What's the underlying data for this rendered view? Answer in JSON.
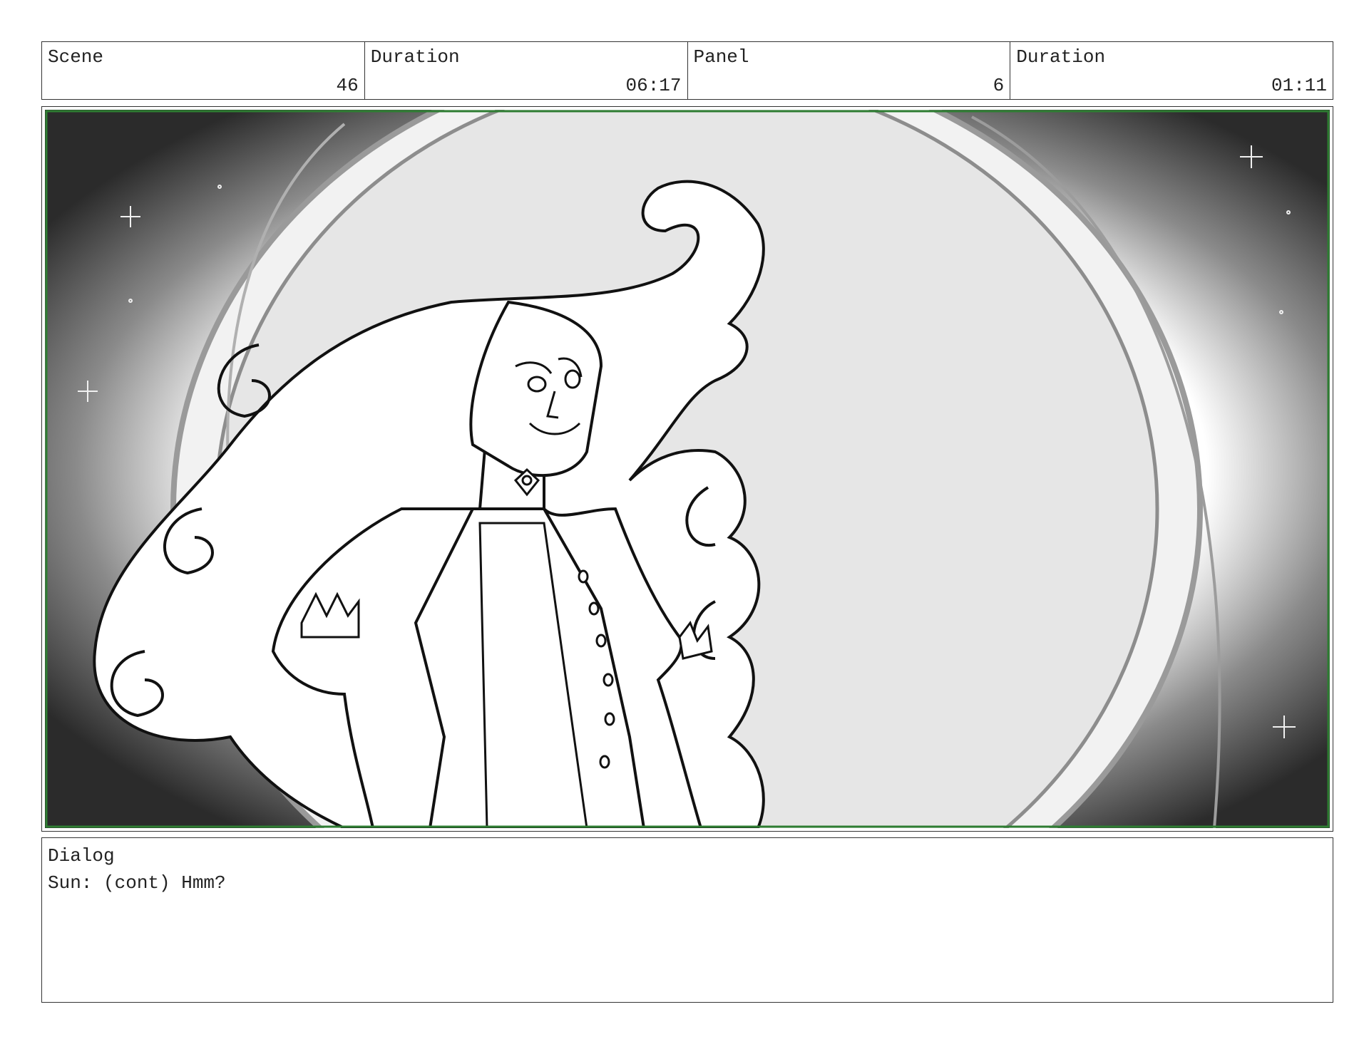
{
  "header": {
    "scene": {
      "label": "Scene",
      "value": "46"
    },
    "scene_duration": {
      "label": "Duration",
      "value": "06:17"
    },
    "panel": {
      "label": "Panel",
      "value": "6"
    },
    "panel_duration": {
      "label": "Duration",
      "value": "01:11"
    }
  },
  "artwork": {
    "frame_color": "#2e7d32",
    "background_color": "#2b2b2b",
    "sun_color": "#e6e6e6",
    "ink_color": "#111111"
  },
  "dialog": {
    "label": "Dialog",
    "text": "Sun: (cont) Hmm?"
  }
}
